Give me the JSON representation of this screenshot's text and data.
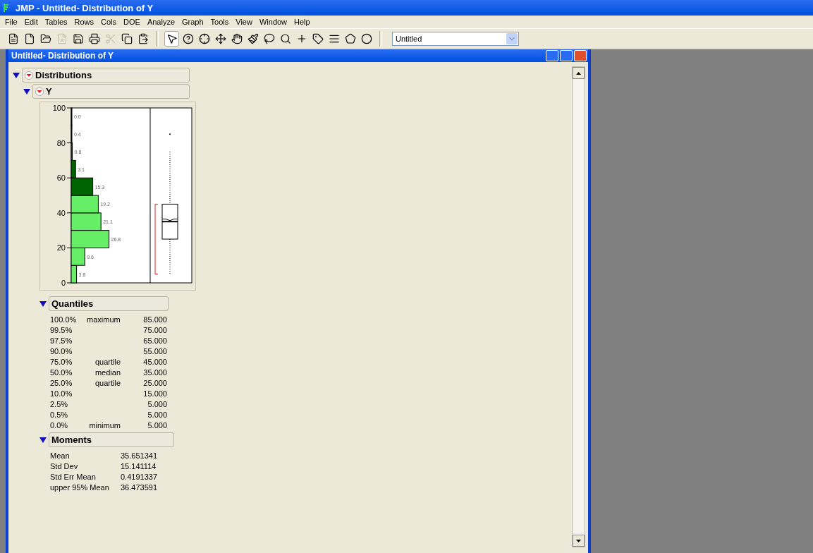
{
  "window": {
    "title": "JMP - Untitled- Distribution of Y"
  },
  "menu": [
    "File",
    "Edit",
    "Tables",
    "Rows",
    "Cols",
    "DOE",
    "Analyze",
    "Graph",
    "Tools",
    "View",
    "Window",
    "Help"
  ],
  "file_buttons": [
    {
      "disabled": false
    },
    {
      "disabled": false
    },
    {
      "disabled": false
    },
    {
      "disabled": true
    },
    {
      "disabled": false
    },
    {
      "disabled": false
    },
    {
      "disabled": true
    },
    {
      "disabled": false
    },
    {
      "disabled": false
    }
  ],
  "tool_buttons": [
    {
      "selected": true
    },
    {
      "selected": false
    },
    {
      "selected": false
    },
    {
      "selected": false
    },
    {
      "selected": false
    },
    {
      "selected": false
    },
    {
      "selected": false
    },
    {
      "selected": false
    },
    {
      "selected": false
    },
    {
      "selected": false
    },
    {
      "selected": false
    },
    {
      "selected": false
    },
    {
      "selected": false
    }
  ],
  "table_select": {
    "value": "Untitled"
  },
  "report_window": {
    "title": "Untitled- Distribution of Y"
  },
  "distributions": {
    "title": "Distributions",
    "expanded": true
  },
  "variable": {
    "title": "Y",
    "expanded": true,
    "chart_data": {
      "type": "bar",
      "orientation": "horizontal",
      "x": [
        5,
        15,
        25,
        35,
        45,
        55,
        65,
        75,
        85,
        95
      ],
      "yticks": [
        0,
        20,
        40,
        60,
        80,
        100
      ],
      "ylim": [
        0,
        100
      ],
      "series": [
        {
          "color": "#66ee66",
          "values": [
            3.8,
            9.6,
            26.8,
            21.1,
            19.2,
            null,
            null,
            null,
            null,
            null
          ],
          "value_labels": [
            "3.8",
            "9.6",
            "26.8",
            "21.1",
            "19.2",
            null,
            null,
            null,
            null,
            null
          ]
        },
        {
          "color": "#006400",
          "values": [
            null,
            null,
            null,
            null,
            null,
            15.3,
            3.1,
            0.8,
            0.4,
            0.0
          ],
          "value_labels": [
            null,
            null,
            null,
            null,
            null,
            "15.3",
            "3.1",
            "0.8",
            "0.4",
            "0.0"
          ]
        }
      ]
    }
  },
  "quantiles": {
    "title": "Quantiles",
    "expanded": true,
    "rows": [
      {
        "percent": "100.0%",
        "label": "maximum",
        "value": "85.000"
      },
      {
        "percent": "99.5%",
        "value": "75.000"
      },
      {
        "percent": "97.5%",
        "value": "65.000"
      },
      {
        "percent": "90.0%",
        "value": "55.000"
      },
      {
        "percent": "75.0%",
        "label": "quartile",
        "value": "45.000"
      },
      {
        "percent": "50.0%",
        "label": "median",
        "value": "35.000"
      },
      {
        "percent": "25.0%",
        "label": "quartile",
        "value": "25.000"
      },
      {
        "percent": "10.0%",
        "value": "15.000"
      },
      {
        "percent": "2.5%",
        "value": "5.000"
      },
      {
        "percent": "0.5%",
        "value": "5.000"
      },
      {
        "percent": "0.0%",
        "label": "minimum",
        "value": "5.000"
      }
    ]
  },
  "moments": {
    "title": "Moments",
    "expanded": true,
    "rows": [
      {
        "name": "Mean",
        "value": "35.651341"
      },
      {
        "name": "Std Dev",
        "value": "15.141114"
      },
      {
        "name": "Std Err Mean",
        "value": "0.4191337"
      },
      {
        "name": "upper 95% Mean",
        "value": "36.473591"
      }
    ]
  }
}
